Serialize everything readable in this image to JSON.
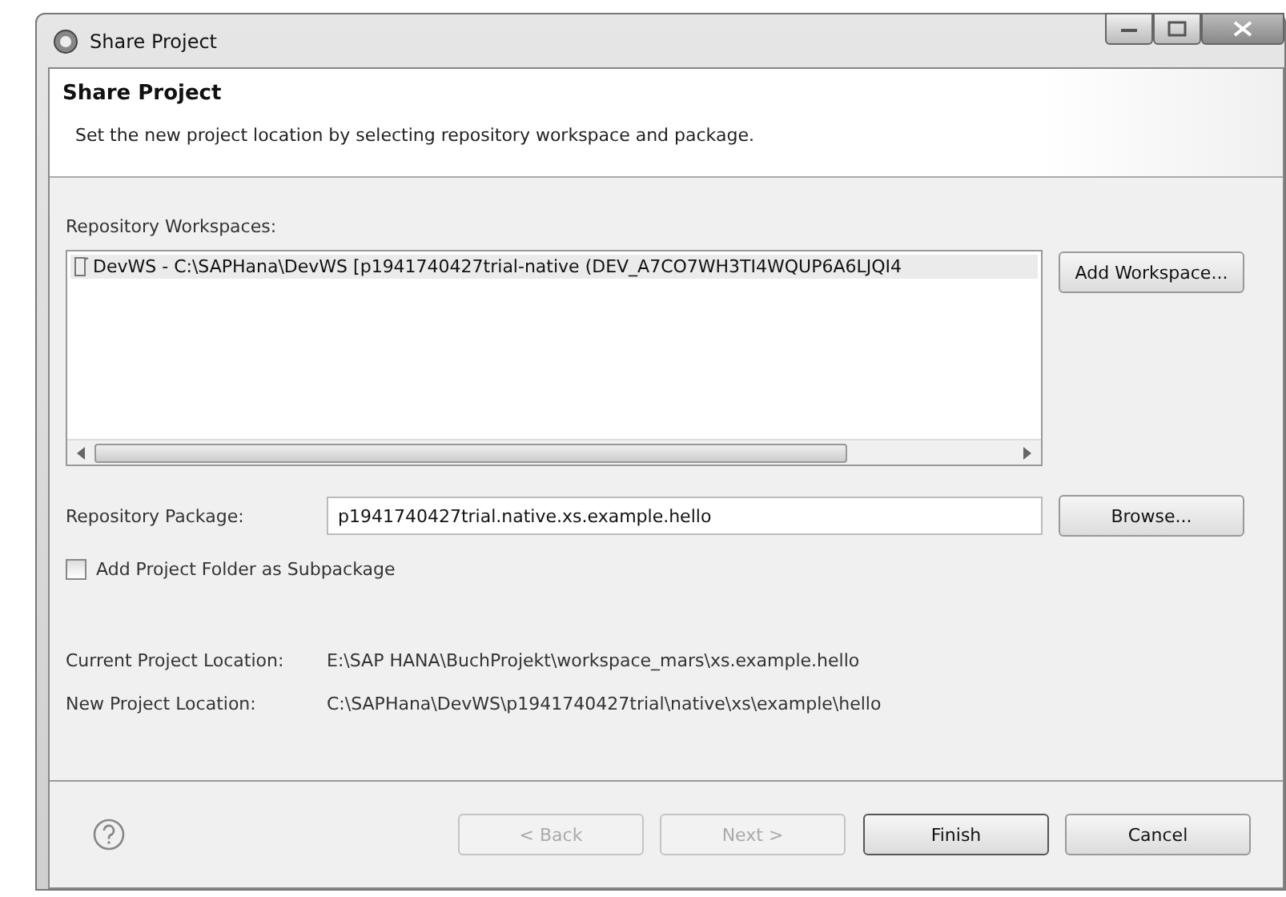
{
  "window": {
    "title": "Share Project"
  },
  "header": {
    "title": "Share Project",
    "description": "Set the new project location by selecting repository workspace and package."
  },
  "workspaces": {
    "label": "Repository Workspaces:",
    "items": [
      {
        "text": "DevWS - C:\\SAPHana\\DevWS [p1941740427trial-native (DEV_A7CO7WH3TI4WQUP6A6LJQI4",
        "selected": true
      }
    ],
    "button": "Add Workspace..."
  },
  "package": {
    "label": "Repository Package:",
    "value": "p1941740427trial.native.xs.example.hello",
    "button": "Browse..."
  },
  "subpackage": {
    "label": "Add Project Folder as Subpackage",
    "checked": false
  },
  "locations": [
    {
      "label": "Current Project Location:",
      "value": "E:\\SAP HANA\\BuchProjekt\\workspace_mars\\xs.example.hello"
    },
    {
      "label": "New Project Location:",
      "value": "C:\\SAPHana\\DevWS\\p1941740427trial\\native\\xs\\example\\hello"
    }
  ],
  "buttons": [
    {
      "label": "< Back",
      "disabled": true,
      "default": false
    },
    {
      "label": "Next >",
      "disabled": true,
      "default": false
    },
    {
      "label": "Finish",
      "disabled": false,
      "default": true
    },
    {
      "label": "Cancel",
      "disabled": false,
      "default": false
    }
  ]
}
